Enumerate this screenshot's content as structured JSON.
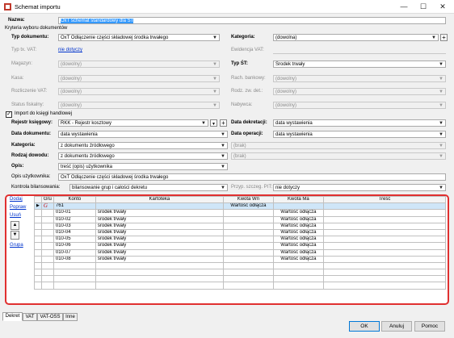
{
  "window": {
    "title": "Schemat importu"
  },
  "name": {
    "label": "Nazwa:",
    "value": "OxT schemat standardowy dla ŚT"
  },
  "criteria": {
    "header": "Kryteria wyboru dokumentów",
    "typ_dokumentu": {
      "label": "Typ dokumentu:",
      "value": "OxT Odłączenie części składowej środka trwałego"
    },
    "typ_tx_vat": {
      "label": "Typ tx. VAT:",
      "value": "nie dotyczy"
    },
    "magazyn": {
      "label": "Magazyn:",
      "value": "(dowolny)"
    },
    "kasa": {
      "label": "Kasa:",
      "value": "(dowolny)"
    },
    "rozliczenie_vat": {
      "label": "Rozliczenie VAT:",
      "value": "(dowolny)"
    },
    "status_fiskalny": {
      "label": "Status fiskalny:",
      "value": "(dowolny)"
    },
    "kategoria": {
      "label": "Kategoria:",
      "value": "(dowolna)"
    },
    "ewidencja_vat": {
      "label": "Ewidencja VAT:",
      "value": ""
    },
    "typ_st": {
      "label": "Typ ŚT:",
      "value": "Środek trwały"
    },
    "rach_bankowy": {
      "label": "Rach. bankowy:",
      "value": "(dowolny)"
    },
    "rodz_zw_det": {
      "label": "Rodz. zw. det.:",
      "value": "(dowolny)"
    },
    "nabywca": {
      "label": "Nabywca:",
      "value": "(dowolny)"
    }
  },
  "import": {
    "checkbox_label": "Import do księgi handlowej",
    "rejestr": {
      "label": "Rejestr księgowy:",
      "value": "RKK - Rejestr kosztowy"
    },
    "data_dokumentu": {
      "label": "Data dokumentu:",
      "value": "data wystawienia"
    },
    "kategoria": {
      "label": "Kategoria:",
      "value": "z dokumentu źródłowego"
    },
    "rodzaj_dowodu": {
      "label": "Rodzaj dowodu:",
      "value": "z dokumentu źródłowego"
    },
    "opis": {
      "label": "Opis:",
      "value": "treść (opis) użytkownika"
    },
    "data_dekretacji": {
      "label": "Data dekretacji:",
      "value": "data wystawienia"
    },
    "data_operacji": {
      "label": "Data operacji:",
      "value": "data wystawienia"
    },
    "brak1": "(brak)",
    "brak2": "(brak)",
    "opis_uzytkownika": {
      "label": "Opis użytkownika:",
      "value": "OxT Odłączenie części składowej środka trwałego"
    },
    "kontrola": {
      "label": "Kontrola bilansowania:",
      "value": "bilansowanie grup i całości dekretu"
    },
    "przyp": {
      "label": "Przyp. szczeg. PIT:",
      "value": "nie dotyczy"
    }
  },
  "side_links": {
    "dodaj": "Dodaj",
    "popraw": "Popraw",
    "usun": "Usuń",
    "grupa": "Grupa"
  },
  "grid": {
    "headers": [
      "",
      "Gru",
      "Konto",
      "Kartoteka",
      "Kwota Wn",
      "Kwota Ma",
      "Treść"
    ],
    "rows": [
      {
        "gru": "G",
        "konto": "761",
        "kartoteka": "",
        "wn": "Wartość odłącza",
        "ma": "",
        "tresc": ""
      },
      {
        "gru": "",
        "konto": "010-01",
        "kartoteka": "środek trwały",
        "wn": "",
        "ma": "Wartość odłącza",
        "tresc": ""
      },
      {
        "gru": "",
        "konto": "010-02",
        "kartoteka": "środek trwały",
        "wn": "",
        "ma": "Wartość odłącza",
        "tresc": ""
      },
      {
        "gru": "",
        "konto": "010-03",
        "kartoteka": "środek trwały",
        "wn": "",
        "ma": "Wartość odłącza",
        "tresc": ""
      },
      {
        "gru": "",
        "konto": "010-04",
        "kartoteka": "środek trwały",
        "wn": "",
        "ma": "Wartość odłącza",
        "tresc": ""
      },
      {
        "gru": "",
        "konto": "010-05",
        "kartoteka": "środek trwały",
        "wn": "",
        "ma": "Wartość odłącza",
        "tresc": ""
      },
      {
        "gru": "",
        "konto": "010-06",
        "kartoteka": "środek trwały",
        "wn": "",
        "ma": "Wartość odłącza",
        "tresc": ""
      },
      {
        "gru": "",
        "konto": "010-07",
        "kartoteka": "środek trwały",
        "wn": "",
        "ma": "Wartość odłącza",
        "tresc": ""
      },
      {
        "gru": "",
        "konto": "010-08",
        "kartoteka": "środek trwały",
        "wn": "",
        "ma": "Wartość odłącza",
        "tresc": ""
      }
    ]
  },
  "tabs": [
    "Dekret",
    "VAT",
    "VAT-OSS",
    "Inne"
  ],
  "buttons": {
    "ok": "OK",
    "cancel": "Anuluj",
    "help": "Pomoc"
  },
  "colors": {
    "accent": "#0078d7",
    "highlight": "#e03030",
    "selection": "#cfe6f8"
  }
}
